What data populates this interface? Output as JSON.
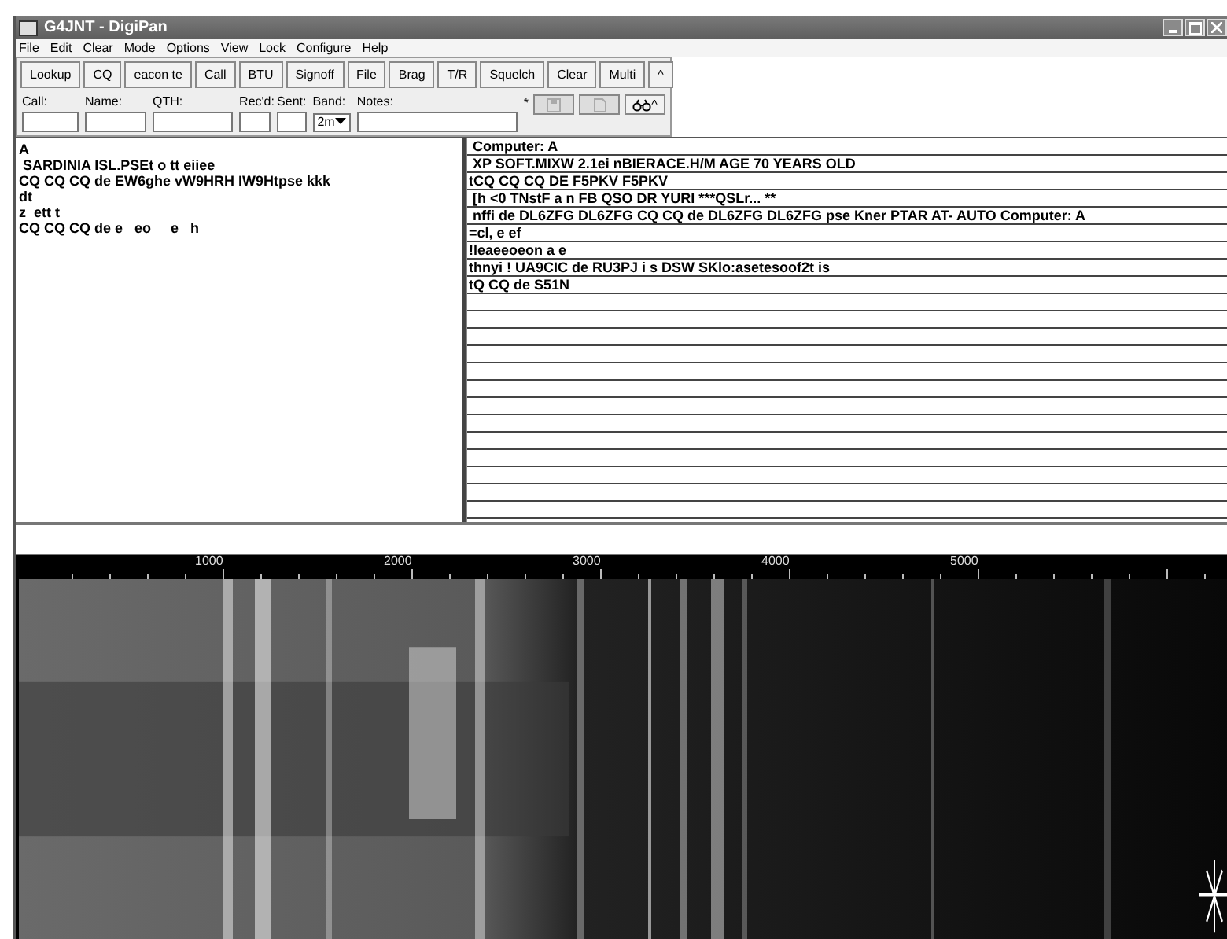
{
  "window": {
    "title": "G4JNT - DigiPan"
  },
  "menu": [
    "File",
    "Edit",
    "Clear",
    "Mode",
    "Options",
    "View",
    "Lock",
    "Configure",
    "Help"
  ],
  "toolbar": [
    "Lookup",
    "CQ",
    "eacon te",
    "Call",
    "BTU",
    "Signoff",
    "File",
    "Brag",
    "T/R",
    "Squelch",
    "Clear",
    "Multi",
    "^"
  ],
  "log_fields": [
    {
      "label": "Call:",
      "kind": "text"
    },
    {
      "label": "Name:",
      "kind": "text"
    },
    {
      "label": "QTH:",
      "kind": "text"
    },
    {
      "label": "Rec'd:",
      "kind": "text"
    },
    {
      "label": "Sent:",
      "kind": "text"
    },
    {
      "label": "Band:",
      "kind": "select",
      "value": "2m"
    },
    {
      "label": "Notes:",
      "kind": "text"
    }
  ],
  "notes_marker": "*",
  "log_buttons": [
    {
      "kind": "save",
      "disabled": true
    },
    {
      "kind": "page",
      "disabled": true
    },
    {
      "kind": "binoculars",
      "disabled": false,
      "label": "^"
    }
  ],
  "receive_pane": [
    "A",
    " SARDINIA ISL.PSEt o tt eiiee",
    "CQ CQ CQ de EW6ghe vW9HRH IW9Htpse kkk",
    "dt",
    "z  ett t",
    "CQ CQ CQ de e   eo     e   h"
  ],
  "channel_rows": [
    " Computer: A",
    " XP SOFT.MIXW 2.1ei nBIERACE.H/M AGE 70 YEARS OLD",
    "tCQ CQ CQ DE F5PKV F5PKV",
    " [h <0 TNstF a n FB QSO DR YURI ***QSLr... **",
    " nffi de DL6ZFG DL6ZFG CQ CQ de DL6ZFG DL6ZFG pse Kner PTAR AT- AUTO Computer: A",
    "=cl, e ef",
    "!leaeeoeon a e",
    "thnyi ! UA9CIC de RU3PJ i s DSW SKlo:asetesoof2t is",
    "tQ CQ de S51N"
  ],
  "waterfall": {
    "scale_labels": [
      "1000",
      "2000",
      "3000",
      "4000",
      "5000"
    ]
  }
}
